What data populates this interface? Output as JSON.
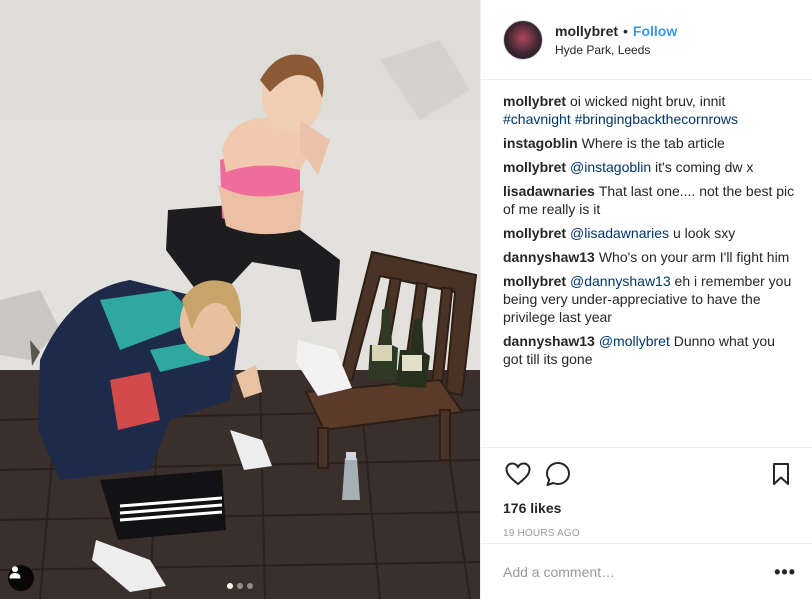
{
  "post": {
    "username": "mollybret",
    "separator": "•",
    "follow_label": "Follow",
    "location": "Hyde Park, Leeds",
    "comments": [
      {
        "author": "mollybret",
        "parts": [
          {
            "t": "text",
            "v": "oi wicked night bruv, innit "
          },
          {
            "t": "tag",
            "v": "#chavnight"
          },
          {
            "t": "text",
            "v": " "
          },
          {
            "t": "tag",
            "v": "#bringingbackthecornrows"
          }
        ]
      },
      {
        "author": "instagoblin",
        "parts": [
          {
            "t": "text",
            "v": "Where is the tab article"
          }
        ]
      },
      {
        "author": "mollybret",
        "parts": [
          {
            "t": "mention",
            "v": "@instagoblin"
          },
          {
            "t": "text",
            "v": " it's coming dw x"
          }
        ]
      },
      {
        "author": "lisadawnaries",
        "parts": [
          {
            "t": "text",
            "v": "That last one.... not the best pic of me really is it"
          }
        ]
      },
      {
        "author": "mollybret",
        "parts": [
          {
            "t": "mention",
            "v": "@lisadawnaries"
          },
          {
            "t": "text",
            "v": " u look sxy"
          }
        ]
      },
      {
        "author": "dannyshaw13",
        "parts": [
          {
            "t": "text",
            "v": "Who's on your arm I'll fight him"
          }
        ]
      },
      {
        "author": "mollybret",
        "parts": [
          {
            "t": "mention",
            "v": "@dannyshaw13"
          },
          {
            "t": "text",
            "v": " eh i remember you being very under-appreciative to have the privilege last year"
          }
        ]
      },
      {
        "author": "dannyshaw13",
        "parts": [
          {
            "t": "mention",
            "v": "@mollybret"
          },
          {
            "t": "text",
            "v": " Dunno what you got till its gone"
          }
        ]
      }
    ],
    "likes_label": "176 likes",
    "timestamp": "19 HOURS AGO",
    "add_comment_placeholder": "Add a comment…",
    "more_label": "•••",
    "carousel": {
      "count": 3,
      "active": 0
    },
    "icons": {
      "like": "heart-icon",
      "comment": "comment-bubble-icon",
      "save": "bookmark-icon",
      "tagged": "person-tag-icon"
    },
    "colors": {
      "link_blue": "#3897f0",
      "hashtag_navy": "#003569",
      "muted_grey": "#999999",
      "text": "#262626"
    }
  }
}
